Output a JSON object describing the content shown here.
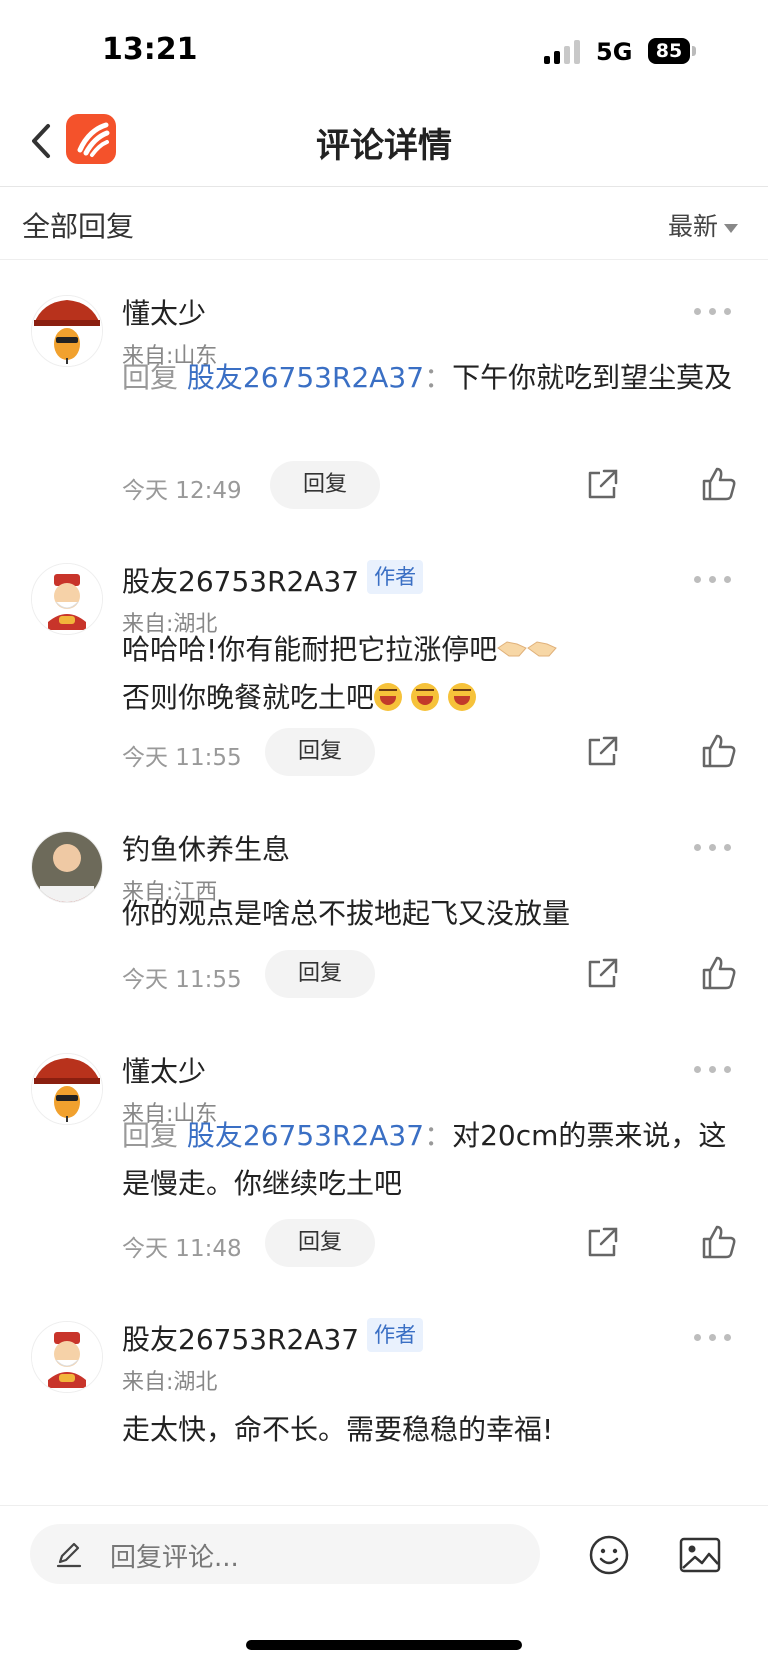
{
  "status_bar": {
    "time": "13:21",
    "network": "5G",
    "battery": "85"
  },
  "header": {
    "title": "评论详情",
    "back_icon": "chevron-left-icon",
    "logo_icon": "app-logo-icon"
  },
  "subbar": {
    "label": "全部回复",
    "sort_label": "最新"
  },
  "comments": [
    {
      "user": "懂太少",
      "is_author": false,
      "location": "来自:山东",
      "reply_prefix": "回复",
      "reply_target": "股友26753R2A37",
      "separator": "：",
      "text": "下午你就吃到望尘莫及",
      "time": "今天 12:49",
      "reply_label": "回复"
    },
    {
      "user": "股友26753R2A37",
      "is_author": true,
      "author_badge": "作者",
      "location": "来自:湖北",
      "text_line1": "哈哈哈!你有能耐把它拉涨停吧",
      "text_line2": "否则你晚餐就吃土吧",
      "time": "今天 11:55",
      "reply_label": "回复"
    },
    {
      "user": "钓鱼休养生息",
      "is_author": false,
      "location": "来自:江西",
      "text": "你的观点是啥总不拔地起飞又没放量",
      "time": "今天 11:55",
      "reply_label": "回复"
    },
    {
      "user": "懂太少",
      "is_author": false,
      "location": "来自:山东",
      "reply_prefix": "回复",
      "reply_target": "股友26753R2A37",
      "separator": "：",
      "text": "对20cm的票来说，这是慢走。你继续吃土吧",
      "time": "今天 11:48",
      "reply_label": "回复"
    },
    {
      "user": "股友26753R2A37",
      "is_author": true,
      "author_badge": "作者",
      "location": "来自:湖北",
      "text": "走太快，命不长。需要稳稳的幸福!"
    }
  ],
  "bottom_bar": {
    "placeholder": "回复评论..."
  },
  "colors": {
    "link": "#3a6fc4",
    "logo": "#f4522b",
    "meta": "#999999"
  }
}
